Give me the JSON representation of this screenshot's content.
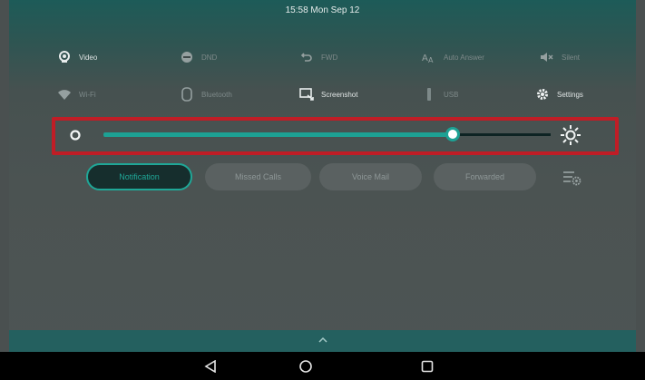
{
  "status": {
    "clock": "15:58 Mon Sep 12"
  },
  "quick_settings": [
    {
      "name": "qs-video",
      "label": "Video",
      "icon": "webcam-icon",
      "on": true
    },
    {
      "name": "qs-dnd",
      "label": "DND",
      "icon": "minus-circle-icon",
      "on": false
    },
    {
      "name": "qs-fwd",
      "label": "FWD",
      "icon": "forward-arrow-icon",
      "on": false
    },
    {
      "name": "qs-auto-answer",
      "label": "Auto Answer",
      "icon": "auto-answer-icon",
      "on": false
    },
    {
      "name": "qs-silent",
      "label": "Silent",
      "icon": "speaker-mute-icon",
      "on": false
    },
    {
      "name": "qs-wifi",
      "label": "Wi-Fi",
      "icon": "wifi-icon",
      "on": false
    },
    {
      "name": "qs-bluetooth",
      "label": "Bluetooth",
      "icon": "bluetooth-icon",
      "on": false
    },
    {
      "name": "qs-screenshot",
      "label": "Screenshot",
      "icon": "screenshot-icon",
      "on": true
    },
    {
      "name": "qs-usb",
      "label": "USB",
      "icon": "usb-icon",
      "on": false
    },
    {
      "name": "qs-settings",
      "label": "Settings",
      "icon": "gear-icon",
      "on": true
    }
  ],
  "brightness": {
    "level": 0.78,
    "min_icon": "brightness-low-icon",
    "max_icon": "brightness-high-icon"
  },
  "tabs": [
    {
      "label": "Notification",
      "active": true
    },
    {
      "label": "Missed Calls",
      "active": false
    },
    {
      "label": "Voice Mail",
      "active": false
    },
    {
      "label": "Forwarded",
      "active": false
    }
  ],
  "notification_settings_icon": "notification-settings-icon",
  "pull_handle_icon": "chevron-up-icon",
  "nav": {
    "back": "back-icon",
    "home": "home-icon",
    "recents": "recents-icon"
  },
  "colors": {
    "accent": "#1da194",
    "highlight": "#c01d26"
  }
}
